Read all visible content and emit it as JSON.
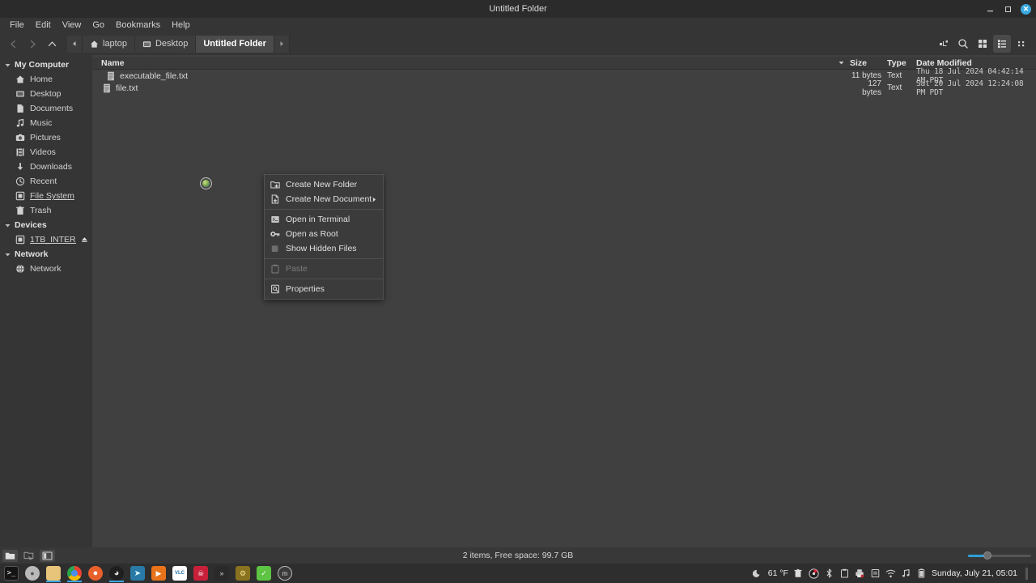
{
  "window": {
    "title": "Untitled Folder",
    "minimize_label": "Minimize",
    "maximize_label": "Maximize",
    "close_label": "Close"
  },
  "menubar": {
    "items": [
      {
        "label": "File"
      },
      {
        "label": "Edit"
      },
      {
        "label": "View"
      },
      {
        "label": "Go"
      },
      {
        "label": "Bookmarks"
      },
      {
        "label": "Help"
      }
    ]
  },
  "toolbar": {
    "back_label": "Back",
    "forward_label": "Forward",
    "up_label": "Up",
    "breadcrumb_prev_label": "Previous path",
    "breadcrumb_next_label": "Next path",
    "breadcrumb": [
      {
        "label": "laptop",
        "icon": "home-icon",
        "current": false
      },
      {
        "label": "Desktop",
        "icon": "folder-icon",
        "current": false
      },
      {
        "label": "Untitled Folder",
        "icon": "",
        "current": true
      }
    ],
    "right_icons": [
      {
        "name": "toggle-location-entry-icon",
        "label": "Toggle Location Entry",
        "active": false
      },
      {
        "name": "search-icon",
        "label": "Search",
        "active": false
      },
      {
        "name": "icon-view-icon",
        "label": "Icon View",
        "active": false
      },
      {
        "name": "list-view-icon",
        "label": "List View",
        "active": true
      },
      {
        "name": "compact-view-icon",
        "label": "Compact View",
        "active": false
      }
    ]
  },
  "sidebar": {
    "groups": [
      {
        "label": "My Computer",
        "expanded": true,
        "items": [
          {
            "label": "Home",
            "icon": "home-icon",
            "underlined": false
          },
          {
            "label": "Desktop",
            "icon": "desktop-icon",
            "underlined": false
          },
          {
            "label": "Documents",
            "icon": "document-icon",
            "underlined": false
          },
          {
            "label": "Music",
            "icon": "music-note-icon",
            "underlined": false
          },
          {
            "label": "Pictures",
            "icon": "camera-icon",
            "underlined": false
          },
          {
            "label": "Videos",
            "icon": "film-icon",
            "underlined": false
          },
          {
            "label": "Downloads",
            "icon": "download-arrow-icon",
            "underlined": false
          },
          {
            "label": "Recent",
            "icon": "clock-icon",
            "underlined": false
          },
          {
            "label": "File System",
            "icon": "drive-icon",
            "underlined": true
          },
          {
            "label": "Trash",
            "icon": "trash-icon",
            "underlined": false
          }
        ]
      },
      {
        "label": "Devices",
        "expanded": true,
        "items": [
          {
            "label": "1TB_INTER...",
            "icon": "drive-icon",
            "underlined": true,
            "eject": true
          }
        ]
      },
      {
        "label": "Network",
        "expanded": true,
        "items": [
          {
            "label": "Network",
            "icon": "globe-icon",
            "underlined": false
          }
        ]
      }
    ]
  },
  "file_list": {
    "columns": {
      "name": "Name",
      "size": "Size",
      "type": "Type",
      "date_modified": "Date Modified"
    },
    "sort_indicator": "chevron-down-icon",
    "rows": [
      {
        "name": "executable_file.txt",
        "size": "11 bytes",
        "type": "Text",
        "date_modified": "Thu 18 Jul 2024 04:42:14 AM PDT",
        "icon": "text-file-icon",
        "indented": true
      },
      {
        "name": "file.txt",
        "size": "127 bytes",
        "type": "Text",
        "date_modified": "Sat 20 Jul 2024 12:24:08 PM PDT",
        "icon": "text-file-icon",
        "indented": false
      }
    ]
  },
  "context_menu": {
    "items": [
      {
        "label": "Create New Folder",
        "icon": "new-folder-icon",
        "disabled": false,
        "submenu": false,
        "separator_after": false
      },
      {
        "label": "Create New Document",
        "icon": "new-document-icon",
        "disabled": false,
        "submenu": true,
        "separator_after": true
      },
      {
        "label": "Open in Terminal",
        "icon": "terminal-icon",
        "disabled": false,
        "submenu": false,
        "separator_after": false
      },
      {
        "label": "Open as Root",
        "icon": "key-icon",
        "disabled": false,
        "submenu": false,
        "separator_after": false
      },
      {
        "label": "Show Hidden Files",
        "icon": "checkbox-icon",
        "disabled": false,
        "submenu": false,
        "separator_after": true
      },
      {
        "label": "Paste",
        "icon": "clipboard-icon",
        "disabled": true,
        "submenu": false,
        "separator_after": true
      },
      {
        "label": "Properties",
        "icon": "properties-icon",
        "disabled": false,
        "submenu": false,
        "separator_after": false
      }
    ]
  },
  "statusbar": {
    "text": "2 items, Free space: 99.7 GB",
    "left_buttons": [
      {
        "name": "places-sidebar-button",
        "label": "Places"
      },
      {
        "name": "treeview-sidebar-button",
        "label": "Treeview"
      },
      {
        "name": "toggle-sidebar-button",
        "label": "Toggle Sidebar"
      }
    ],
    "zoom_label": "Zoom"
  },
  "taskbar": {
    "apps": [
      {
        "name": "terminal-app",
        "label": "Terminal",
        "color": "#1b1b1b",
        "text": ">_",
        "running": false
      },
      {
        "name": "system-app",
        "label": "System",
        "color": "#c9c9c9",
        "text": "●",
        "running": false
      },
      {
        "name": "files-app",
        "label": "Files",
        "color": "#e8c37a",
        "text": "",
        "running": true
      },
      {
        "name": "chrome-app",
        "label": "Chrome",
        "color": "#ffffff",
        "text": "",
        "running": true
      },
      {
        "name": "firefox-app",
        "label": "Firefox",
        "color": "#e8602c",
        "text": "",
        "running": false
      },
      {
        "name": "steam-app",
        "label": "Steam",
        "color": "#1f1f1f",
        "text": "",
        "running": true
      },
      {
        "name": "steam-blue-app",
        "label": "Steam",
        "color": "#2a7aa8",
        "text": "",
        "running": false
      },
      {
        "name": "media-player-app",
        "label": "Media Player",
        "color": "#e8731a",
        "text": "▶",
        "running": false
      },
      {
        "name": "vlc-app",
        "label": "VLC",
        "color": "#ffffff",
        "text": "VLC",
        "running": false
      },
      {
        "name": "games-app",
        "label": "Games",
        "color": "#c8203a",
        "text": "",
        "running": false
      },
      {
        "name": "video-editor-app",
        "label": "Video Editor",
        "color": "#2a2a2a",
        "text": "»",
        "running": false
      },
      {
        "name": "tools-app",
        "label": "Tools",
        "color": "#8a7320",
        "text": "",
        "running": false
      },
      {
        "name": "utility-app",
        "label": "Utility",
        "color": "#5ec443",
        "text": "",
        "running": false
      },
      {
        "name": "mint-menu-app",
        "label": "Mint Menu",
        "color": "#3a3a3a",
        "text": "m",
        "running": false
      }
    ],
    "tray": {
      "weather_icon": "moon-icon",
      "temperature": "61 °F",
      "icons": [
        {
          "name": "trash-tray-icon",
          "label": "Trash"
        },
        {
          "name": "disc-tray-icon",
          "label": "Disc"
        },
        {
          "name": "bluetooth-tray-icon",
          "label": "Bluetooth"
        },
        {
          "name": "clipboard-tray-icon",
          "label": "Clipboard"
        },
        {
          "name": "printer-tray-icon",
          "label": "Printer"
        },
        {
          "name": "notes-tray-icon",
          "label": "Notes"
        },
        {
          "name": "wifi-tray-icon",
          "label": "Network"
        },
        {
          "name": "volume-tray-icon",
          "label": "Volume"
        },
        {
          "name": "battery-tray-icon",
          "label": "Battery"
        }
      ],
      "clock": "Sunday, July 21, 05:01"
    }
  },
  "colors": {
    "titlebar": "#2b2b2b",
    "chrome": "#353535",
    "content": "#404040",
    "accent": "#3ba9e0",
    "taskbar": "#2e2e2e"
  }
}
